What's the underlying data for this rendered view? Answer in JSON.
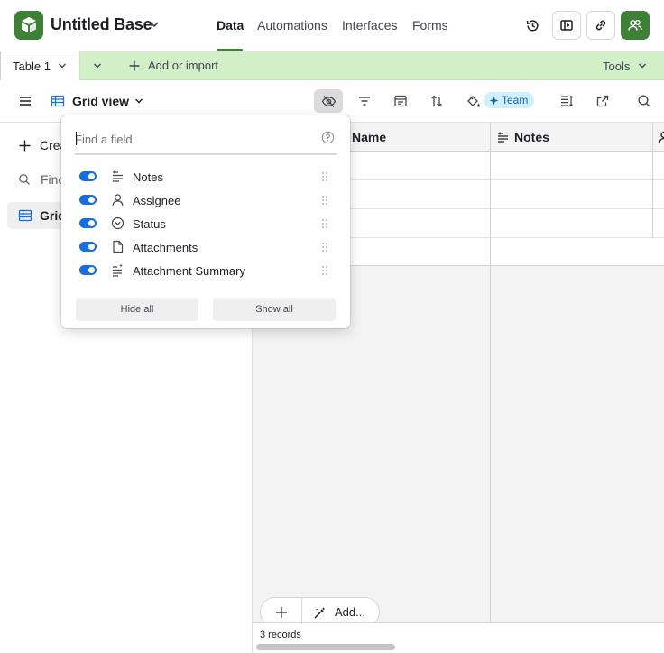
{
  "header": {
    "base_title": "Untitled Base",
    "nav_tabs": [
      "Data",
      "Automations",
      "Interfaces",
      "Forms"
    ],
    "active_tab": "Data",
    "brand_color": "#3e8035"
  },
  "tables_bar": {
    "table_name": "Table 1",
    "add_or_import": "Add or import",
    "tools": "Tools",
    "bar_color": "#d2f0c8"
  },
  "view_toolbar": {
    "view_name": "Grid view",
    "team_badge": "Team"
  },
  "sidebar": {
    "create_label": "Crea",
    "find_label": "Find",
    "view_item_label": "Grid"
  },
  "grid": {
    "columns": [
      "Name",
      "Notes"
    ],
    "records_label": "3 records",
    "add_label": "Add..."
  },
  "hide_fields_popover": {
    "search_placeholder": "Find a field",
    "fields": [
      {
        "label": "Notes",
        "icon": "long-text-icon",
        "visible": true
      },
      {
        "label": "Assignee",
        "icon": "user-icon",
        "visible": true
      },
      {
        "label": "Status",
        "icon": "single-select-icon",
        "visible": true
      },
      {
        "label": "Attachments",
        "icon": "file-icon",
        "visible": true
      },
      {
        "label": "Attachment Summary",
        "icon": "ai-text-icon",
        "visible": true
      }
    ],
    "hide_all": "Hide all",
    "show_all": "Show all",
    "toggle_color": "#166ee1"
  }
}
